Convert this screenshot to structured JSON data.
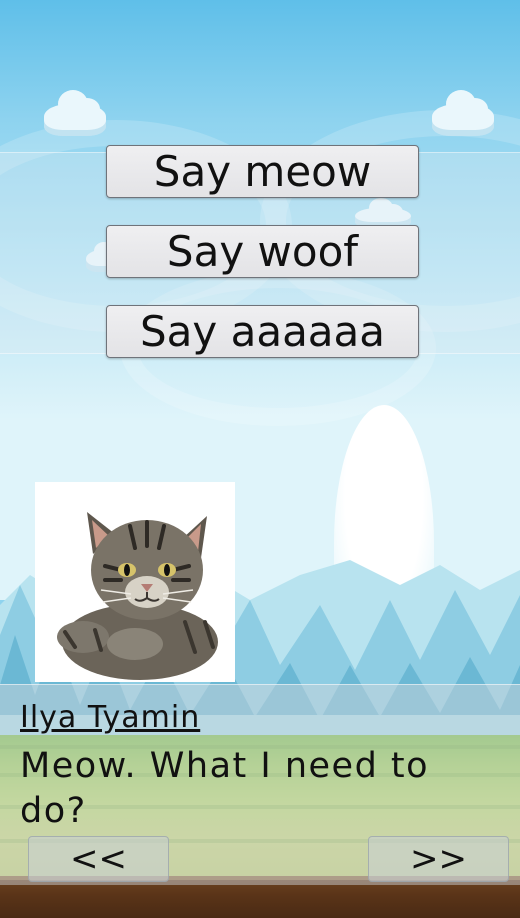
{
  "choices": {
    "option_1": "Say meow",
    "option_2": "Say woof",
    "option_3": "Say aaaaaa"
  },
  "dialog": {
    "speaker": "Ilya Tyamin",
    "text": "Meow. What I need to do?",
    "prev_label": "<<",
    "next_label": ">>"
  },
  "portrait": {
    "subject": "tabby-cat-icon"
  },
  "colors": {
    "sky": "#8fd3ee",
    "button_face": "#e6e6e9",
    "button_border": "#6f737a",
    "text": "#111111",
    "grass": "#9dce58",
    "dirt": "#5a3418"
  }
}
